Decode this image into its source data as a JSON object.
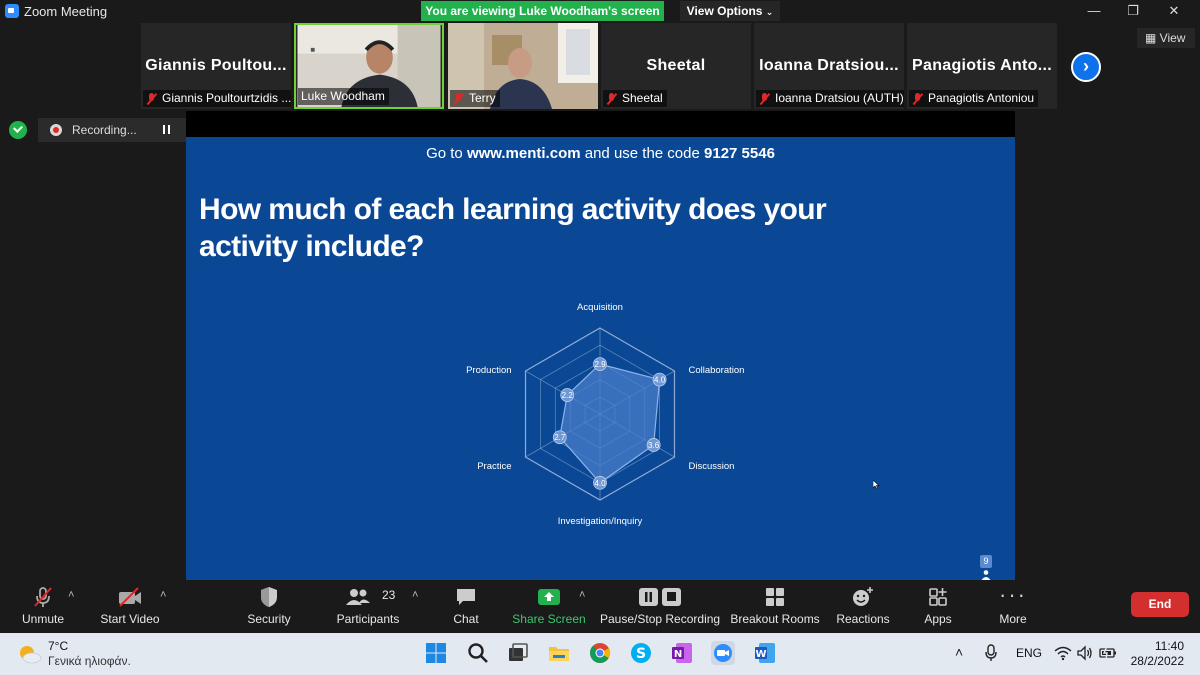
{
  "window": {
    "title": "Zoom Meeting",
    "viewing_banner": "You are viewing Luke Woodham's screen",
    "view_options": "View Options",
    "view_button": "View",
    "controls": {
      "minimize": "—",
      "restore": "❐",
      "close": "✕"
    }
  },
  "participants": [
    {
      "display": "Giannis  Poultou...",
      "name": "Giannis Poultourtzidis ...",
      "muted": true,
      "video": false
    },
    {
      "display": "",
      "name": "Luke Woodham",
      "muted": false,
      "video": true
    },
    {
      "display": "",
      "name": "Terry",
      "muted": true,
      "video": true
    },
    {
      "display": "Sheetal",
      "name": "Sheetal",
      "muted": true,
      "video": false
    },
    {
      "display": "Ioanna  Dratsiou...",
      "name": "Ioanna Dratsiou (AUTH)",
      "muted": true,
      "video": false
    },
    {
      "display": "Panagiotis  Anto...",
      "name": "Panagiotis Antoniou",
      "muted": true,
      "video": false
    }
  ],
  "recording": {
    "label": "Recording..."
  },
  "slide": {
    "menti_prefix": "Go to ",
    "menti_url": "www.menti.com",
    "menti_middle": " and use the code ",
    "menti_code": "9127 5546",
    "question": "How much of each learning activity does your activity include?",
    "response_count": "9"
  },
  "chart_data": {
    "type": "radar",
    "categories": [
      "Acquisition",
      "Collaboration",
      "Discussion",
      "Investigation/Inquiry",
      "Practice",
      "Production"
    ],
    "values": [
      2.9,
      4.0,
      3.6,
      4.0,
      2.7,
      2.2
    ],
    "value_labels": [
      "2.9",
      "4.0",
      "3.6",
      "4.0",
      "2.7",
      "2.2"
    ],
    "scale_max": 5,
    "rings": 5,
    "colors": {
      "fill": "#4a7ec9",
      "stroke": "#8fb3e6",
      "grid": "#9db6d9",
      "background": "#0a4896"
    }
  },
  "toolbar": {
    "unmute": "Unmute",
    "start_video": "Start Video",
    "security": "Security",
    "participants": "Participants",
    "participants_count": "23",
    "chat": "Chat",
    "share_screen": "Share Screen",
    "pause_stop": "Pause/Stop Recording",
    "breakout": "Breakout Rooms",
    "reactions": "Reactions",
    "apps": "Apps",
    "more": "More",
    "end": "End"
  },
  "taskbar": {
    "weather_temp": "7°C",
    "weather_desc": "Γενικά ηλιοφάν.",
    "language": "ENG",
    "time": "11:40",
    "date": "28/2/2022",
    "apps": [
      "windows-start",
      "search",
      "task-view",
      "file-explorer",
      "chrome",
      "skype",
      "onenote",
      "zoom",
      "word"
    ]
  }
}
